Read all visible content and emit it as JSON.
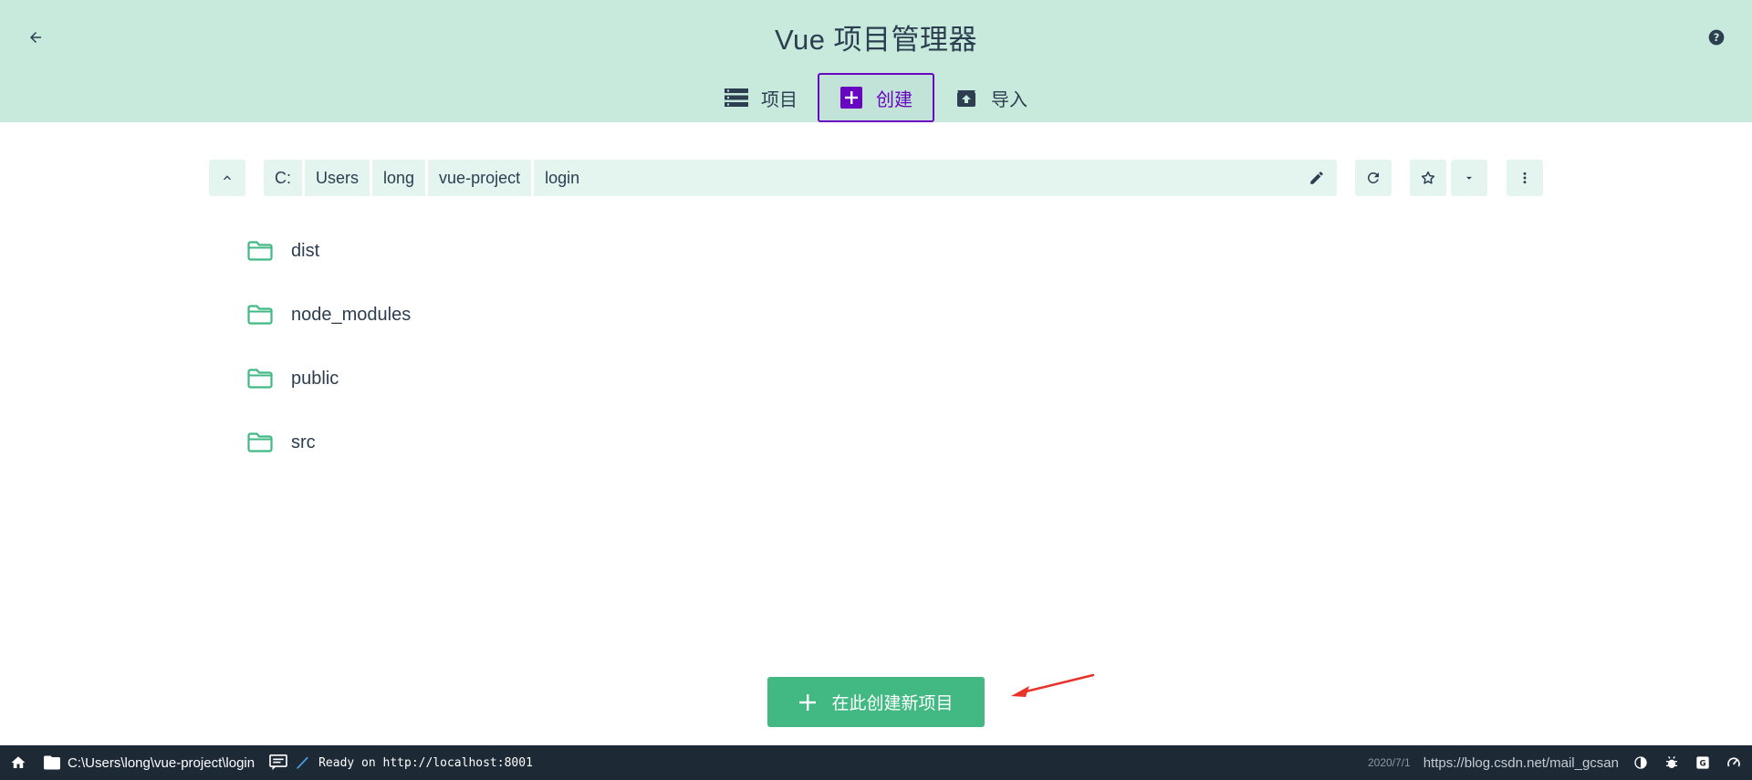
{
  "header": {
    "title": "Vue 项目管理器",
    "tabs": [
      {
        "label": "项目",
        "icon": "list-icon",
        "active": false
      },
      {
        "label": "创建",
        "icon": "add-box-icon",
        "active": true
      },
      {
        "label": "导入",
        "icon": "unarchive-icon",
        "active": false
      }
    ]
  },
  "pathbar": {
    "crumbs": [
      "C:",
      "Users",
      "long",
      "vue-project",
      "login"
    ]
  },
  "folders": [
    {
      "name": "dist"
    },
    {
      "name": "node_modules"
    },
    {
      "name": "public"
    },
    {
      "name": "src"
    }
  ],
  "create_button": {
    "label": "在此创建新项目"
  },
  "statusbar": {
    "path": "C:\\Users\\long\\vue-project\\login",
    "log": "Ready on http://localhost:8001",
    "date": "2020/7/1",
    "watermark": "https://blog.csdn.net/mail_gcsan"
  },
  "colors": {
    "header_bg": "#c7eadd",
    "accent": "#42b983",
    "active_tab": "#6806c1",
    "statusbar_bg": "#1d2935",
    "annotation_arrow": "#e8332a"
  }
}
